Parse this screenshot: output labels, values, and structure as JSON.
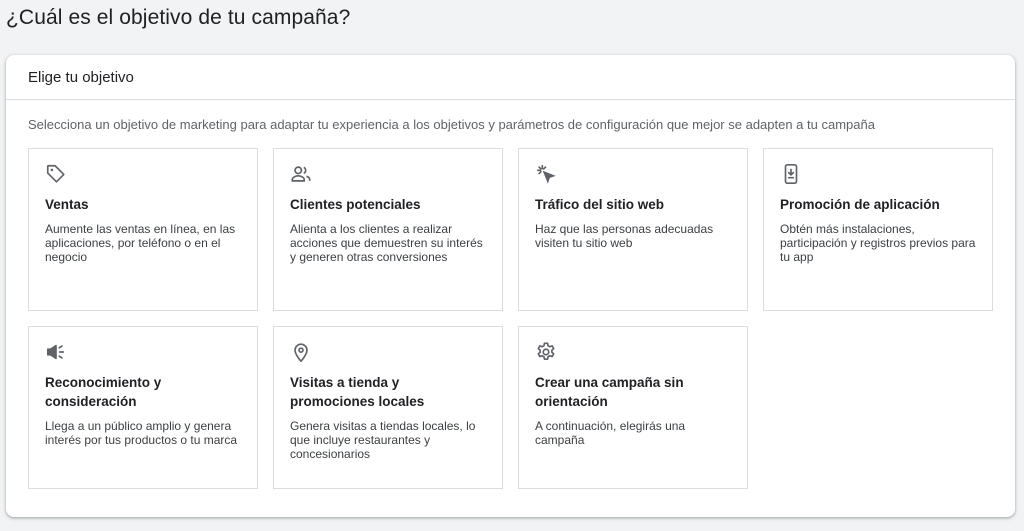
{
  "page": {
    "title": "¿Cuál es el objetivo de tu campaña?"
  },
  "panel": {
    "title": "Elige tu objetivo",
    "subtitle": "Selecciona un objetivo de marketing para adaptar tu experiencia a los objetivos y parámetros de configuración que mejor se adapten a tu campaña"
  },
  "cards": [
    {
      "icon": "tag-icon",
      "title": "Ventas",
      "desc": "Aumente las ventas en línea, en las aplicaciones, por teléfono o en el negocio"
    },
    {
      "icon": "people-icon",
      "title": "Clientes potenciales",
      "desc": "Alienta a los clientes a realizar acciones que demuestren su interés y generen otras conversiones"
    },
    {
      "icon": "cursor-click-icon",
      "title": "Tráfico del sitio web",
      "desc": "Haz que las personas adecuadas visiten tu sitio web"
    },
    {
      "icon": "phone-download-icon",
      "title": "Promoción de aplicación",
      "desc": "Obtén más instalaciones, participación y registros previos para tu app"
    },
    {
      "icon": "megaphone-icon",
      "title": "Reconocimiento y consideración",
      "desc": "Llega a un público amplio y genera interés por tus productos o tu marca"
    },
    {
      "icon": "location-pin-icon",
      "title": "Visitas a tienda y promociones locales",
      "desc": "Genera visitas a tiendas locales, lo que incluye restaurantes y concesionarios"
    },
    {
      "icon": "gear-icon",
      "title": "Crear una campaña sin orientación",
      "desc": "A continuación, elegirás una campaña"
    }
  ],
  "colors": {
    "background": "#f1f3f4",
    "border": "#dadce0",
    "text_primary": "#202124",
    "text_secondary": "#5f6368",
    "icon": "#5f6368"
  }
}
